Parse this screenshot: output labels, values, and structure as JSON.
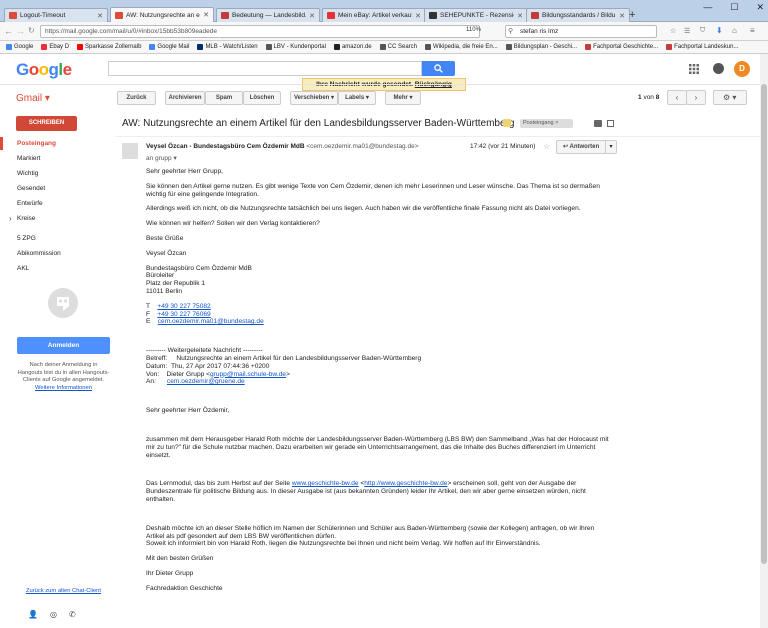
{
  "browser": {
    "tabs": [
      {
        "title": "Logout-Timeout",
        "color": "#dd4b39",
        "active": false
      },
      {
        "title": "AW: Nutzungsrechte an ei...",
        "color": "#dd4b39",
        "active": true
      },
      {
        "title": "Bedeutung — Landesbild...",
        "color": "#c23c3c",
        "active": false
      },
      {
        "title": "Mein eBay: Artikel verkauf...",
        "color": "#e53238",
        "active": false
      },
      {
        "title": "SEHEPUNKTE - Rezension ...",
        "color": "#333333",
        "active": false
      },
      {
        "title": "Bildungsstandards / Bildu...",
        "color": "#c23c3c",
        "active": false
      }
    ],
    "url": "https://mail.google.com/mail/u/0/#inbox/15bb53b809eadede",
    "zoom": "110%",
    "websearch": "stefan ris lmz",
    "window_controls": [
      "—",
      "☐",
      "✕"
    ],
    "bookmarks": [
      {
        "label": "Google",
        "color": "#4285f4"
      },
      {
        "label": "Ebay D",
        "color": "#e53238"
      },
      {
        "label": "Sparkasse Zollernalb",
        "color": "#ff0000"
      },
      {
        "label": "Google Mail",
        "color": "#4285f4"
      },
      {
        "label": "MLB - Watch/Listen",
        "color": "#002d72"
      },
      {
        "label": "LBV - Kundenportal",
        "color": "#555555"
      },
      {
        "label": "amazon.de",
        "color": "#222222"
      },
      {
        "label": "CC Search",
        "color": "#555555"
      },
      {
        "label": "Wikipedia, die freie En...",
        "color": "#555555"
      },
      {
        "label": "Bildungsplan - Geschi...",
        "color": "#555555"
      },
      {
        "label": "Fachportal Geschichte...",
        "color": "#c23c3c"
      },
      {
        "label": "Fachportal Landeskun...",
        "color": "#c23c3c"
      }
    ]
  },
  "header": {
    "logo": "Google",
    "toast_text": "Ihre Nachricht wurde gesendet.",
    "toast_undo": "Rückgängig",
    "avatar_letter": "D"
  },
  "toolbar": {
    "gmail_label": "Gmail ▾",
    "back": "Zurück",
    "archive": "Archivieren",
    "spam": "Spam",
    "delete": "Löschen",
    "move": "Verschieben ▾",
    "labels": "Labels ▾",
    "more": "Mehr ▾",
    "page_range": "1",
    "page_of": "von",
    "page_total": "8"
  },
  "sidebar": {
    "compose": "SCHREIBEN",
    "items": [
      {
        "label": "Posteingang",
        "selected": true
      },
      {
        "label": "Markiert",
        "selected": false
      },
      {
        "label": "Wichtig",
        "selected": false
      },
      {
        "label": "Gesendet",
        "selected": false
      },
      {
        "label": "Entwürfe",
        "selected": false
      },
      {
        "label": "Kreise",
        "selected": false
      },
      {
        "label": "5 ZPG",
        "selected": false
      },
      {
        "label": "Abikommission",
        "selected": false
      },
      {
        "label": "AKL",
        "selected": false
      }
    ],
    "signin": "Anmelden",
    "hangouts_text": "Nach deiner Anmeldung in Hangouts bist du in allen Hangouts-Clients auf Google angemeldet.",
    "hangouts_link": "Weitere Informationen",
    "chat_client": "Zurück zum alten Chat-Client"
  },
  "email": {
    "subject": "AW: Nutzungsrechte an einem Artikel für den Landesbildungsserver Baden-Württemberg",
    "label": "Posteingang",
    "sender_name": "Veysel Özcan - Bundestagsbüro Cem Özdemir MdB",
    "sender_email": "<cem.oezdemir.ma01@bundestag.de>",
    "to": "an grupp ▾",
    "time": "17:42 (vor 21 Minuten)",
    "reply": "Antworten",
    "body": {
      "greeting": "Sehr geehrter Herr Grupp,",
      "p1": "Sie können den Artikel gerne nutzen. Es gibt wenige Texte von Cem Özdemir, denen ich mehr Leserinnen und Leser wünsche. Das Thema ist so dermaßen wichtig für eine gelingende Integration.",
      "p2": "Allerdings weiß ich nicht, ob die Nutzungsrechte tatsächlich bei uns liegen. Auch haben wir die veröffentliche finale Fassung nicht als Datei vorliegen.",
      "p3": "Wie können wir helfen? Sollen wir den Verlag kontaktieren?",
      "closing": "Beste Grüße",
      "name": "Veysel Özcan",
      "sig1": "Bundestagsbüro Cem Özdemir MdB",
      "sig2": "Büroleiter",
      "sig3": "Platz der Republik 1",
      "sig4": "11011 Berlin",
      "tel_label": "T",
      "tel": "+49 30 227 75082",
      "fax_label": "F",
      "fax": "+49 30 227 76069",
      "mail_label": "E",
      "mail": "cem.oezdemir.ma01@bundestag.de",
      "fwd_header": "--------- Weitergeleitete Nachricht ---------",
      "fwd_subject_label": "Betreff:",
      "fwd_subject": "Nutzungsrechte an einem Artikel für den Landesbildungsserver Baden-Württemberg",
      "fwd_date_label": "Datum:",
      "fwd_date": "Thu, 27 Apr 2017 07:44:36 +0200",
      "fwd_from_label": "Von:",
      "fwd_from_name": "Dieter Grupp <",
      "fwd_from_email": "grupp@mail.schule-bw.de",
      "fwd_from_end": ">",
      "fwd_to_label": "An:",
      "fwd_to": "cem.oezdemir@gruene.de",
      "q_greeting": "Sehr geehrter Herr Özdemir,",
      "q1": "zusammen mit dem Herausgeber Harald Roth möchte der Landesbildungsserver Baden-Württemberg (LBS BW) den Sammelband „Was hat der Holocaust mit mir zu tun?\" für die Schule nutzbar machen. Dazu erarbeiten wir gerade ein Unterrichtsarrangement, das die Inhalte des Buches differenziert im Unterricht einsetzt.",
      "q2a": "Das Lernmodul, das bis zum Herbst auf der Seite ",
      "q2link1": "www.geschichte-bw.de",
      "q2b": " <",
      "q2link2": "http://www.geschichte-bw.de",
      "q2c": "> erscheinen soll, geht von der Ausgabe der Bundeszentrale für politische Bildung aus. In dieser Ausgabe ist (aus bekannten Gründen) leider Ihr Artikel, den wir aber gerne einsetzen würden, nicht enthalten.",
      "q3": "Deshalb möchte ich an dieser Stelle höflich im Namen der Schülerinnen und Schüler aus Baden-Württemberg (sowie der Kollegen) anfragen, ob wir Ihren Artikel als pdf gesondert auf dem LBS BW veröffentlichen dürfen.",
      "q3b": "Soweit ich informiert bin von Harald Roth, liegen die Nutzungsrechte bei Ihnen und nicht beim Verlag. Wir hoffen auf Ihr Einverständnis.",
      "q_closing": "Mit den besten Grüßen",
      "q_name": "Ihr Dieter Grupp",
      "q_sig": "Fachredaktion Geschichte"
    }
  }
}
